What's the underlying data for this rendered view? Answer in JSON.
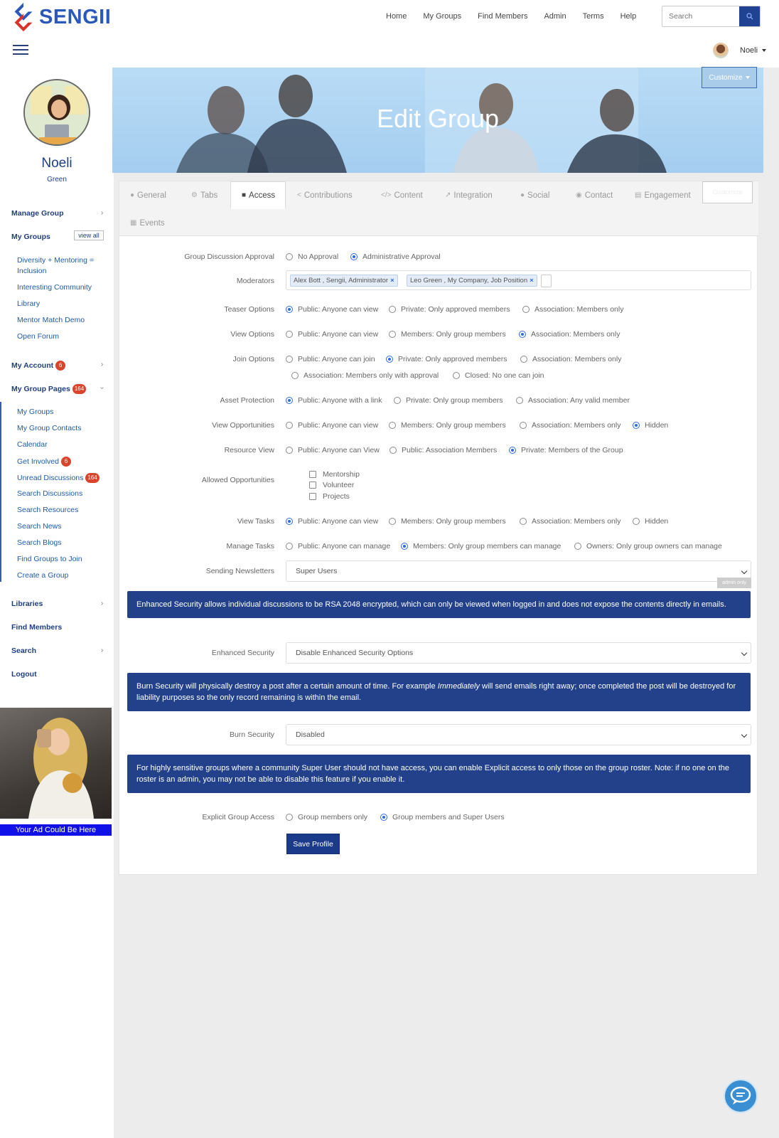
{
  "brand": {
    "name": "SENGII",
    "color": "#2a59b9",
    "accent": "#d7332a"
  },
  "nav": {
    "items": [
      "Home",
      "My Groups",
      "Find Members",
      "Admin",
      "Terms",
      "Help"
    ]
  },
  "search": {
    "placeholder": "Search"
  },
  "user": {
    "name": "Noeli"
  },
  "profile": {
    "first_name": "Noeli",
    "last_name": "Green"
  },
  "sidebar": {
    "manage_group": "Manage Group",
    "my_groups": "My Groups",
    "view_all": "view all",
    "groups": [
      "Diversity + Mentoring =",
      "Inclusion",
      "Interesting Community",
      "Library",
      "Mentor Match Demo",
      "Open Forum"
    ],
    "my_account": "My Account",
    "my_account_badge": "6",
    "my_group_pages": "My Group Pages",
    "my_group_pages_badge": "164",
    "pages": [
      "My Groups",
      "My Group Contacts",
      "Calendar",
      "Get Involved",
      "Unread Discussions",
      "Search Discussions",
      "Search Resources",
      "Search News",
      "Search Blogs",
      "Find Groups to Join",
      "Create a Group"
    ],
    "get_involved_badge": "6",
    "unread_badge": "164",
    "libraries": "Libraries",
    "find_members": "Find Members",
    "search": "Search",
    "logout": "Logout",
    "ad_caption": "Your Ad Could Be Here"
  },
  "hero": {
    "title": "Edit Group",
    "customize": "Customize"
  },
  "tabs": [
    "General",
    "Tabs",
    "Access",
    "Contributions",
    "Content",
    "Integration",
    "Social",
    "Contact",
    "Engagement",
    "Events"
  ],
  "tab_ghost": "Customize",
  "form": {
    "discussion_approval": {
      "label": "Group Discussion Approval",
      "options": [
        "No Approval",
        "Administrative Approval"
      ]
    },
    "moderators": {
      "label": "Moderators",
      "tags": [
        "Alex Bott , Sengii, Administrator",
        "Leo Green , My Company, Job Position"
      ]
    },
    "teaser": {
      "label": "Teaser Options",
      "options": [
        "Public: Anyone can view",
        "Private: Only approved members",
        "Association: Members only"
      ]
    },
    "view": {
      "label": "View Options",
      "options": [
        "Public: Anyone can view",
        "Members: Only group members",
        "Association: Members only"
      ]
    },
    "join": {
      "label": "Join Options",
      "options": [
        "Public: Anyone can join",
        "Private: Only approved members",
        "Association: Members only",
        "Association: Members only with approval",
        "Closed: No one can join"
      ]
    },
    "asset": {
      "label": "Asset Protection",
      "options": [
        "Public: Anyone with a link",
        "Private: Only group members",
        "Association: Any valid member"
      ]
    },
    "opportunities": {
      "label": "View Opportunities",
      "options": [
        "Public: Anyone can view",
        "Members: Only group members",
        "Association: Members only",
        "Hidden"
      ]
    },
    "resource": {
      "label": "Resource View",
      "options": [
        "Public: Anyone can View",
        "Public: Association Members",
        "Private: Members of the Group"
      ]
    },
    "allowed": {
      "label": "Allowed Opportunities",
      "options": [
        "Mentorship",
        "Volunteer",
        "Projects"
      ]
    },
    "tasks": {
      "label": "View Tasks",
      "options": [
        "Public: Anyone can view",
        "Members: Only group members",
        "Association: Members only",
        "Hidden"
      ]
    },
    "manage_tasks": {
      "label": "Manage Tasks",
      "options": [
        "Public: Anyone can manage",
        "Members: Only group members can manage",
        "Owners: Only group owners can manage"
      ]
    },
    "newsletters": {
      "label": "Sending Newsletters",
      "value": "Super Users",
      "admin_only": "admin only"
    },
    "info_enhanced": "Enhanced Security allows individual discussions to be RSA 2048 encrypted, which can only be viewed when logged in and does not expose the contents directly in emails.",
    "enhanced": {
      "label": "Enhanced Security",
      "value": "Disable Enhanced Security Options"
    },
    "info_burn_pre": "Burn Security will physically destroy a post after a certain amount of time. For example ",
    "info_burn_em": "Immediately",
    "info_burn_post": " will send emails right away; once completed the post will be destroyed for liability purposes so the only record remaining is within the email.",
    "burn": {
      "label": "Burn Security",
      "value": "Disabled"
    },
    "info_explicit": "For highly sensitive groups where a community Super User should not have access, you can enable Explicit access to only those on the group roster. Note: if no one on the roster is an admin, you may not be able to disable this feature if you enable it.",
    "explicit": {
      "label": "Explicit Group Access",
      "options": [
        "Group members only",
        "Group members and Super Users"
      ]
    },
    "save": "Save Profile"
  }
}
